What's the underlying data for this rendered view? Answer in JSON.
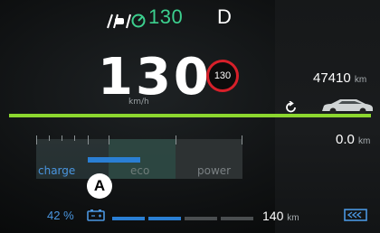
{
  "status": {
    "set_speed": "130",
    "gear": "D",
    "assist_icon": "driver-assist-icon",
    "set_speed_icon": "cruise-control-icon"
  },
  "speed": {
    "value": "130",
    "unit": "km/h",
    "limit": "130"
  },
  "odometer": {
    "value": "47410",
    "unit": "km"
  },
  "trip": {
    "value": "0.0",
    "unit": "km"
  },
  "power_meter": {
    "zones": {
      "charge": "charge",
      "eco": "eco",
      "power": "power"
    },
    "marker": "A",
    "level_fraction": 0.27
  },
  "battery": {
    "percent": "42 %",
    "range_value": "140",
    "range_unit": "km",
    "icon": "battery-icon",
    "regen_icon": "regen-braking-icon"
  },
  "colors": {
    "accent_green": "#8cd72f",
    "set_speed_green": "#3ccf8e",
    "charge_blue": "#4a96e0",
    "limit_red": "#d7202a"
  }
}
